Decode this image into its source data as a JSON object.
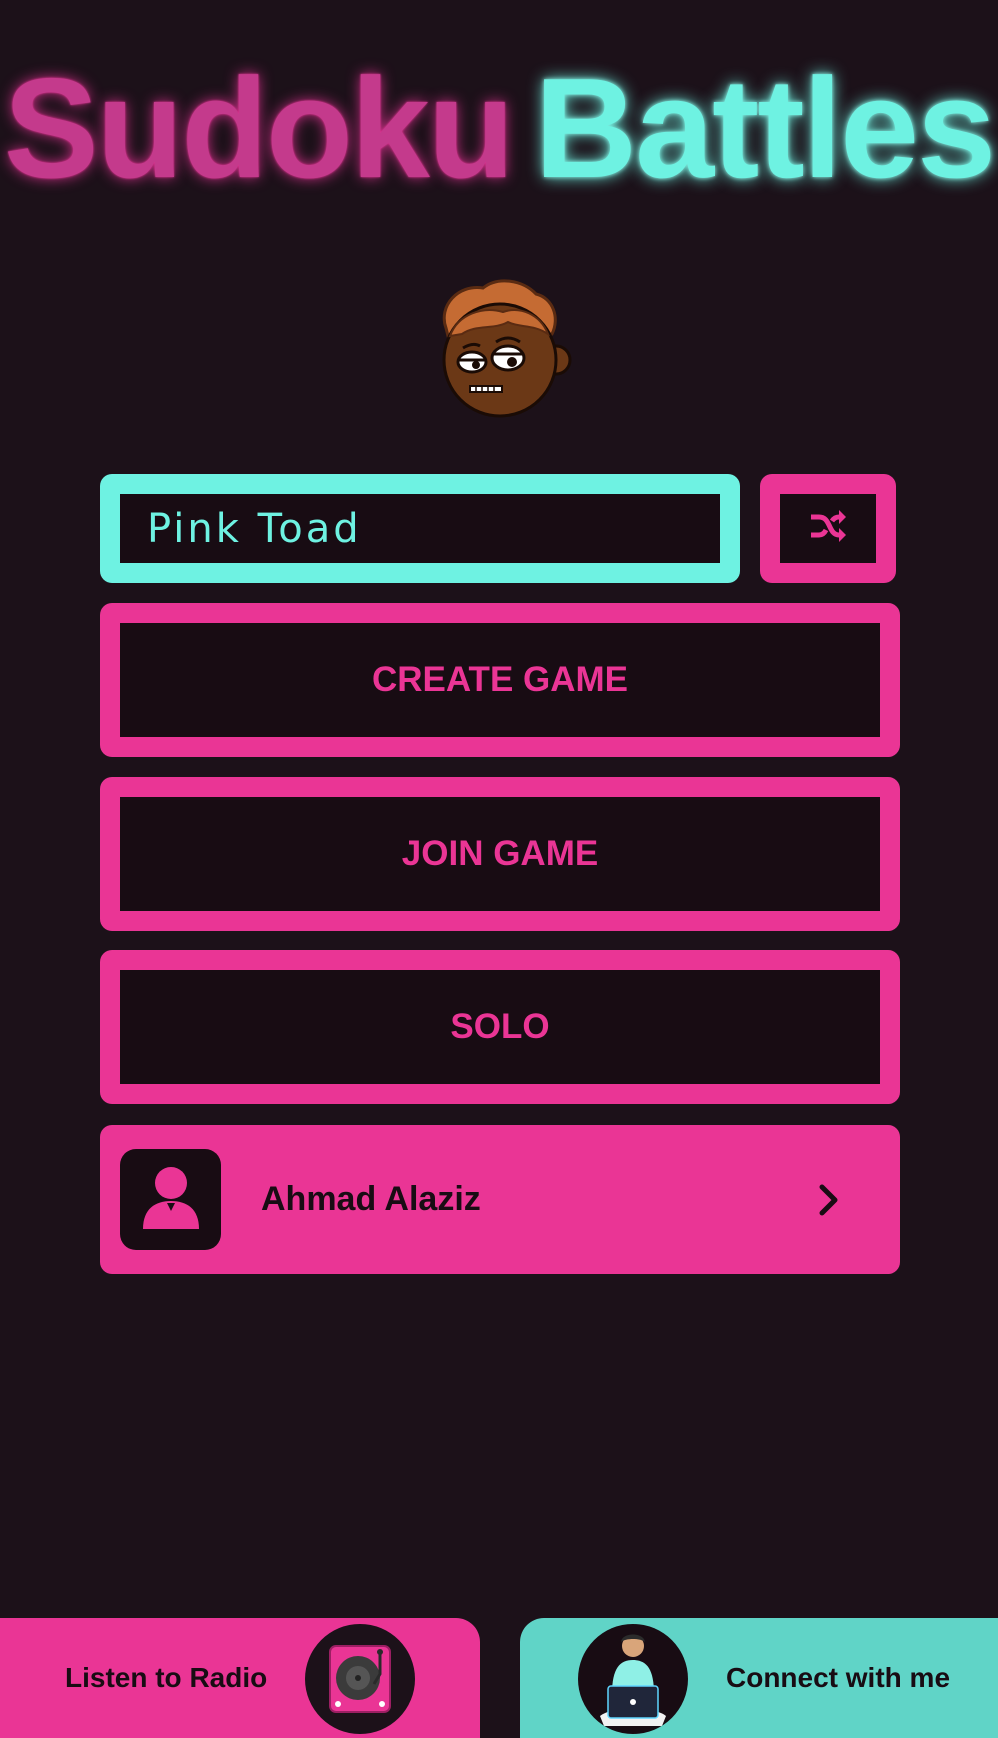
{
  "header": {
    "title_part1": "Sudoku",
    "title_part2": "Battles"
  },
  "player": {
    "avatar_icon": "cartoon-face-avatar",
    "name_value": "Pink Toad",
    "shuffle_icon": "shuffle-icon"
  },
  "menu": {
    "create_label": "CREATE GAME",
    "join_label": "JOIN GAME",
    "solo_label": "SOLO"
  },
  "profile": {
    "name": "Ahmad Alaziz",
    "icon": "user-icon",
    "chevron_icon": "chevron-right-icon"
  },
  "footer": {
    "radio_label": "Listen to Radio",
    "radio_icon": "turntable-icon",
    "connect_label": "Connect with me",
    "connect_icon": "developer-laptop-icon"
  },
  "colors": {
    "background": "#1c1119",
    "pink": "#ea3595",
    "cyan": "#6ef2e2",
    "teal_footer": "#60d4c7",
    "dark": "#180c13"
  }
}
